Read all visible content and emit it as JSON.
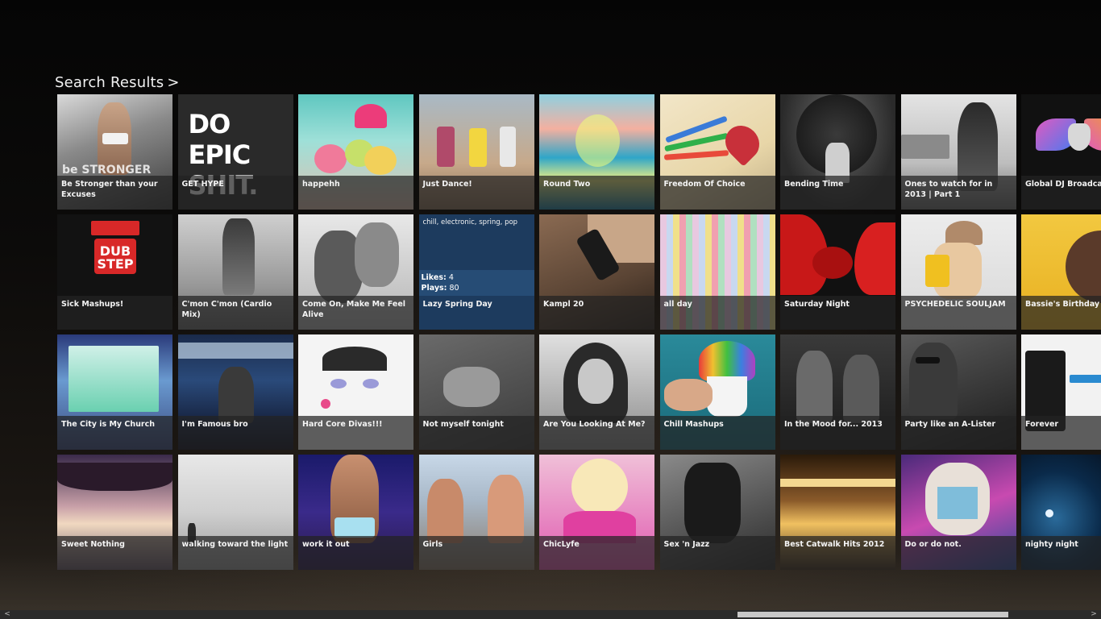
{
  "page": {
    "title": "Search Results",
    "title_chevron": ">"
  },
  "tiles": [
    {
      "title": "Be Stronger than your Excuses",
      "art": "fitness-woman",
      "overlay": "be STRONGER"
    },
    {
      "title": "GET HYPE",
      "art": "do-epic-shit",
      "overlay": "DO EPIC SHIT."
    },
    {
      "title": "happehh",
      "art": "ice-cream-hands"
    },
    {
      "title": "Just Dance!",
      "art": "lego-figures"
    },
    {
      "title": "Round Two",
      "art": "psychedelic-sea"
    },
    {
      "title": "Freedom Of Choice",
      "art": "colored-pencils-heart"
    },
    {
      "title": "Bending Time",
      "art": "tree-woman"
    },
    {
      "title": "Ones to watch for in 2013 | Part 1",
      "art": "woman-ship-bw"
    },
    {
      "title": "Global DJ Broadcast",
      "art": "winged-logo"
    },
    {
      "title": "Sick Mashups!",
      "art": "dubstep-poster",
      "overlay": "DUB STEP"
    },
    {
      "title": "C'mon C'mon (Cardio Mix)",
      "art": "runner-bw"
    },
    {
      "title": "Come On, Make Me Feel Alive",
      "art": "couple-embrace"
    },
    {
      "title": "Lazy Spring Day",
      "art": "selected",
      "tags": "chill, electronic, spring, pop",
      "likes_label": "Likes:",
      "likes": "4",
      "plays_label": "Plays:",
      "plays": "80"
    },
    {
      "title": "Kampl 20",
      "art": "beard-comb"
    },
    {
      "title": "all day",
      "art": "pattern-stripes"
    },
    {
      "title": "Saturday Night",
      "art": "red-cherries"
    },
    {
      "title": "PSYCHEDELIC SOULJAM",
      "art": "girl-cap"
    },
    {
      "title": "Bassie's Birthday M",
      "art": "bulldog-yellow"
    },
    {
      "title": "The City is My Church",
      "art": "city-church"
    },
    {
      "title": "I'm Famous bro",
      "art": "dj-crowd"
    },
    {
      "title": "Hard Core Divas!!!",
      "art": "sketch-face"
    },
    {
      "title": "Not myself tonight",
      "art": "couple-bed-bw"
    },
    {
      "title": "Are You Looking At Me?",
      "art": "audrey-bw"
    },
    {
      "title": "Chill Mashups",
      "art": "snow-cone"
    },
    {
      "title": "In the Mood for... 2013",
      "art": "duo-bw"
    },
    {
      "title": "Party like an A-Lister",
      "art": "man-sunglasses"
    },
    {
      "title": "Forever",
      "art": "skeleton-hands"
    },
    {
      "title": "Sweet Nothing",
      "art": "upside-city"
    },
    {
      "title": "walking toward the light",
      "art": "beach-walk"
    },
    {
      "title": "work it out",
      "art": "fitness-blue"
    },
    {
      "title": "Girls",
      "art": "girls-city"
    },
    {
      "title": "ChicLyfe",
      "art": "pink-blonde"
    },
    {
      "title": "Sex 'n Jazz",
      "art": "dancer-bw"
    },
    {
      "title": "Best Catwalk Hits 2012",
      "art": "catwalk"
    },
    {
      "title": "Do or do not.",
      "art": "tiger-galaxy"
    },
    {
      "title": "nighty night",
      "art": "night-moon"
    }
  ],
  "scrollbar": {
    "left_arrow": "<",
    "right_arrow": ">"
  },
  "colors": {
    "selected_tile": "#1d3b5e",
    "caption_bar": "#232323",
    "scroll_thumb": "#c8c8c8"
  }
}
